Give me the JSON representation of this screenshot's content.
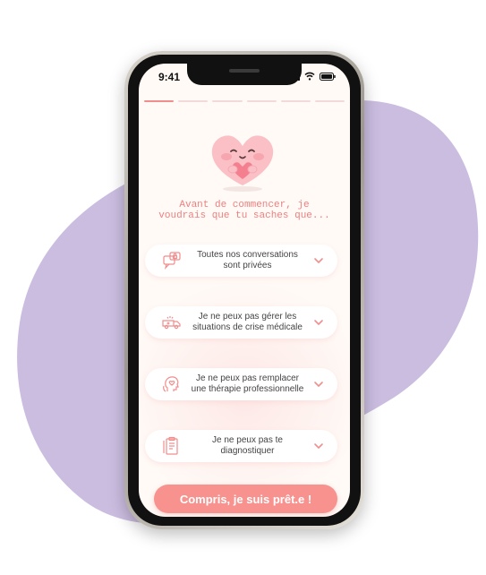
{
  "status_bar": {
    "time": "9:41"
  },
  "intro": {
    "line1": "Avant de commencer, je",
    "line2": "voudrais que tu saches que..."
  },
  "items": [
    {
      "line1": "Toutes nos conversations",
      "line2": "sont privées",
      "icon": "private-chat-icon"
    },
    {
      "line1": "Je ne peux pas gérer les",
      "line2": "situations de crise médicale",
      "icon": "ambulance-icon"
    },
    {
      "line1": "Je ne peux pas remplacer",
      "line2": "une thérapie professionnelle",
      "icon": "therapy-head-icon"
    },
    {
      "line1": "Je ne peux pas te",
      "line2": "diagnostiquer",
      "icon": "clipboard-icon"
    }
  ],
  "cta": {
    "label": "Compris, je suis prêt.e !"
  },
  "colors": {
    "accent": "#f7928e",
    "blob": "#cbbde0",
    "background": "#fffaf6"
  }
}
